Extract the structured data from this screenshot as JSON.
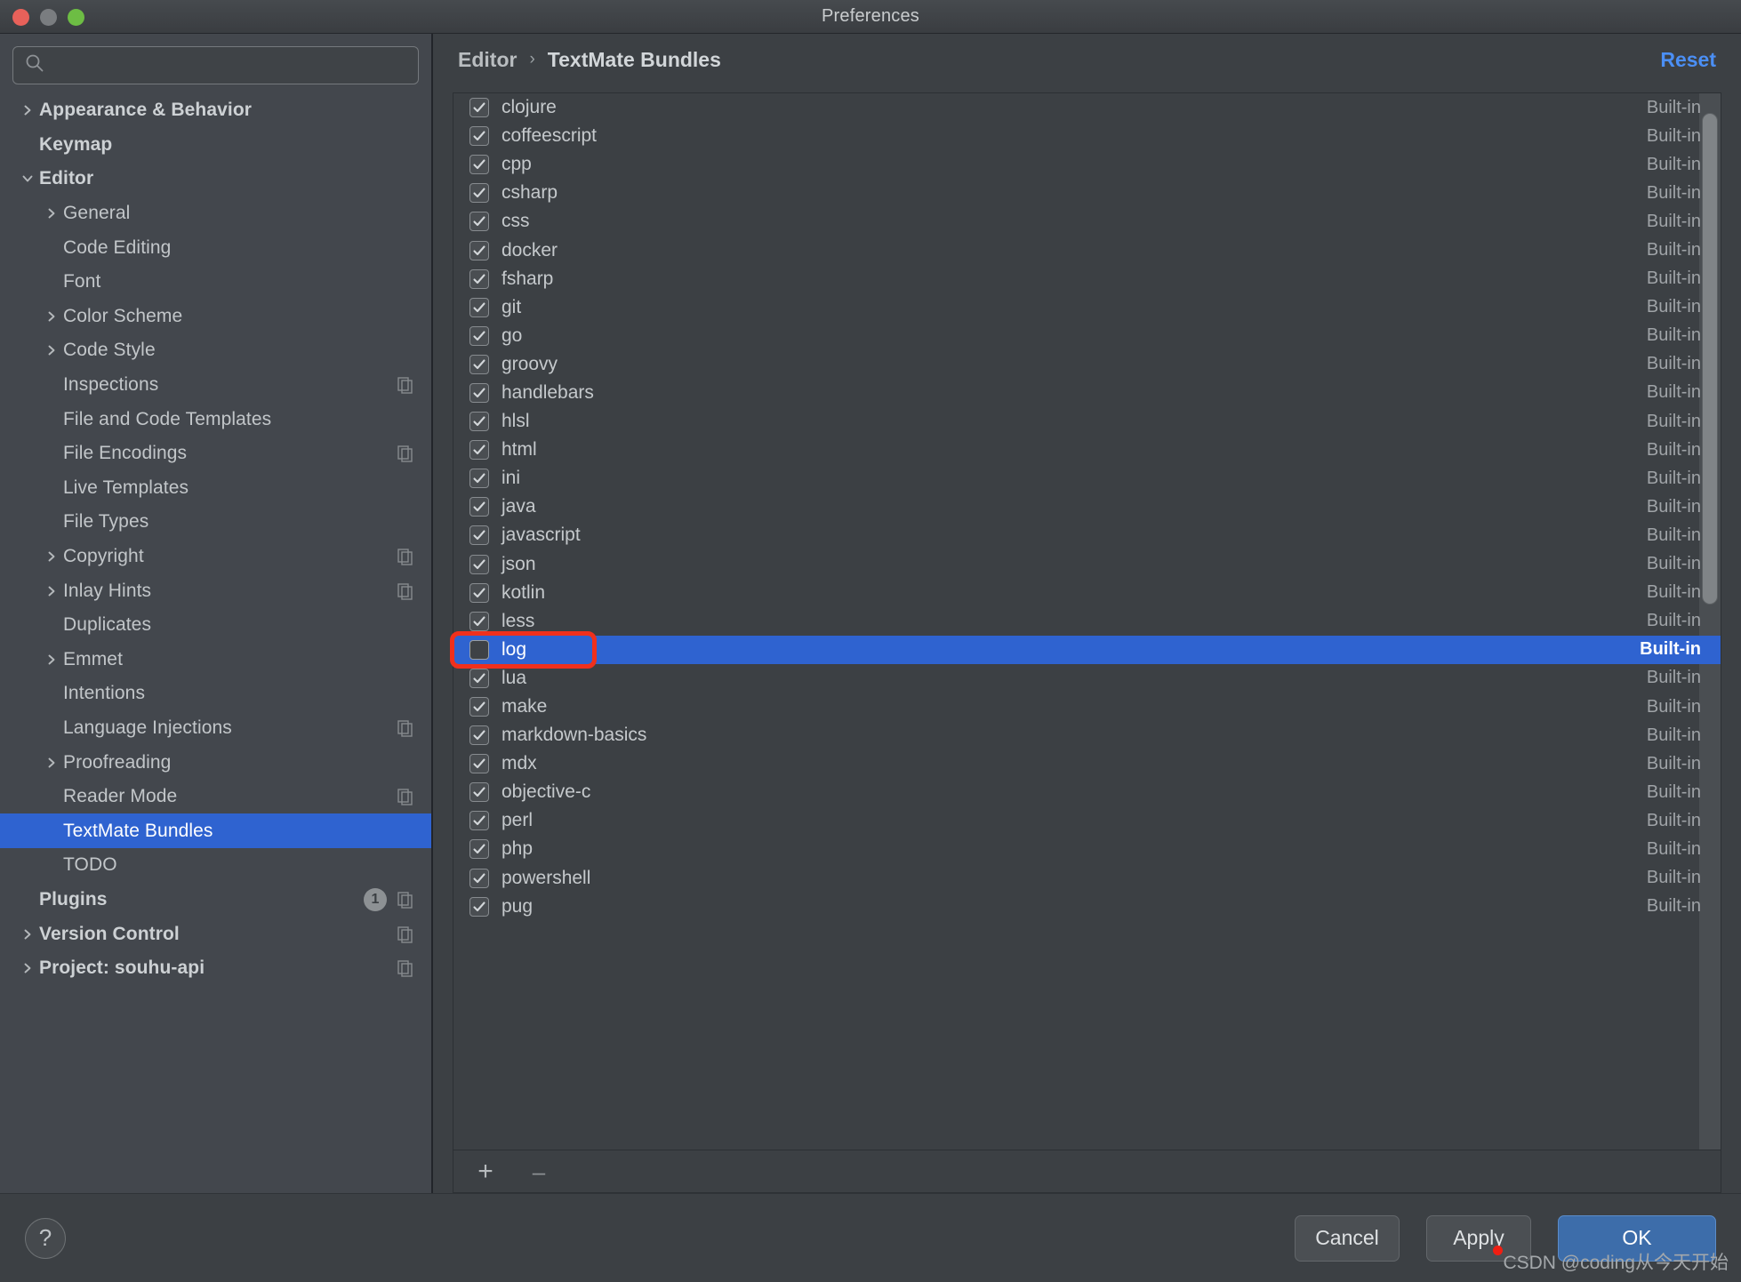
{
  "window": {
    "title": "Preferences",
    "traffic_lights": [
      "close-button",
      "minimize-button",
      "maximize-button"
    ]
  },
  "sidebar": {
    "search": {
      "value": "",
      "placeholder": ""
    },
    "items": [
      {
        "label": "Appearance & Behavior",
        "indent": 0,
        "arrow": "collapsed",
        "bold": true,
        "copy": false,
        "selected": false
      },
      {
        "label": "Keymap",
        "indent": 0,
        "arrow": "none",
        "bold": true,
        "copy": false,
        "selected": false
      },
      {
        "label": "Editor",
        "indent": 0,
        "arrow": "expanded",
        "bold": true,
        "copy": false,
        "selected": false
      },
      {
        "label": "General",
        "indent": 1,
        "arrow": "collapsed",
        "bold": false,
        "copy": false,
        "selected": false
      },
      {
        "label": "Code Editing",
        "indent": 1,
        "arrow": "none",
        "bold": false,
        "copy": false,
        "selected": false
      },
      {
        "label": "Font",
        "indent": 1,
        "arrow": "none",
        "bold": false,
        "copy": false,
        "selected": false
      },
      {
        "label": "Color Scheme",
        "indent": 1,
        "arrow": "collapsed",
        "bold": false,
        "copy": false,
        "selected": false
      },
      {
        "label": "Code Style",
        "indent": 1,
        "arrow": "collapsed",
        "bold": false,
        "copy": false,
        "selected": false
      },
      {
        "label": "Inspections",
        "indent": 1,
        "arrow": "none",
        "bold": false,
        "copy": true,
        "selected": false
      },
      {
        "label": "File and Code Templates",
        "indent": 1,
        "arrow": "none",
        "bold": false,
        "copy": false,
        "selected": false
      },
      {
        "label": "File Encodings",
        "indent": 1,
        "arrow": "none",
        "bold": false,
        "copy": true,
        "selected": false
      },
      {
        "label": "Live Templates",
        "indent": 1,
        "arrow": "none",
        "bold": false,
        "copy": false,
        "selected": false
      },
      {
        "label": "File Types",
        "indent": 1,
        "arrow": "none",
        "bold": false,
        "copy": false,
        "selected": false
      },
      {
        "label": "Copyright",
        "indent": 1,
        "arrow": "collapsed",
        "bold": false,
        "copy": true,
        "selected": false
      },
      {
        "label": "Inlay Hints",
        "indent": 1,
        "arrow": "collapsed",
        "bold": false,
        "copy": true,
        "selected": false
      },
      {
        "label": "Duplicates",
        "indent": 1,
        "arrow": "none",
        "bold": false,
        "copy": false,
        "selected": false
      },
      {
        "label": "Emmet",
        "indent": 1,
        "arrow": "collapsed",
        "bold": false,
        "copy": false,
        "selected": false
      },
      {
        "label": "Intentions",
        "indent": 1,
        "arrow": "none",
        "bold": false,
        "copy": false,
        "selected": false
      },
      {
        "label": "Language Injections",
        "indent": 1,
        "arrow": "none",
        "bold": false,
        "copy": true,
        "selected": false
      },
      {
        "label": "Proofreading",
        "indent": 1,
        "arrow": "collapsed",
        "bold": false,
        "copy": false,
        "selected": false
      },
      {
        "label": "Reader Mode",
        "indent": 1,
        "arrow": "none",
        "bold": false,
        "copy": true,
        "selected": false
      },
      {
        "label": "TextMate Bundles",
        "indent": 1,
        "arrow": "none",
        "bold": false,
        "copy": false,
        "selected": true
      },
      {
        "label": "TODO",
        "indent": 1,
        "arrow": "none",
        "bold": false,
        "copy": false,
        "selected": false
      },
      {
        "label": "Plugins",
        "indent": 0,
        "arrow": "none",
        "bold": true,
        "copy": true,
        "selected": false,
        "badge": "1"
      },
      {
        "label": "Version Control",
        "indent": 0,
        "arrow": "collapsed",
        "bold": true,
        "copy": true,
        "selected": false
      },
      {
        "label": "Project: souhu-api",
        "indent": 0,
        "arrow": "collapsed",
        "bold": true,
        "copy": true,
        "selected": false
      }
    ]
  },
  "main": {
    "breadcrumb": {
      "parent": "Editor",
      "separator": "›",
      "current": "TextMate Bundles"
    },
    "reset_label": "Reset",
    "origin_builtin": "Built-in",
    "toolbar": {
      "add_label": "+",
      "remove_label": "–"
    },
    "bundles": [
      {
        "name": "clojure",
        "checked": true,
        "origin": "Built-in",
        "selected": false
      },
      {
        "name": "coffeescript",
        "checked": true,
        "origin": "Built-in",
        "selected": false
      },
      {
        "name": "cpp",
        "checked": true,
        "origin": "Built-in",
        "selected": false
      },
      {
        "name": "csharp",
        "checked": true,
        "origin": "Built-in",
        "selected": false
      },
      {
        "name": "css",
        "checked": true,
        "origin": "Built-in",
        "selected": false
      },
      {
        "name": "docker",
        "checked": true,
        "origin": "Built-in",
        "selected": false
      },
      {
        "name": "fsharp",
        "checked": true,
        "origin": "Built-in",
        "selected": false
      },
      {
        "name": "git",
        "checked": true,
        "origin": "Built-in",
        "selected": false
      },
      {
        "name": "go",
        "checked": true,
        "origin": "Built-in",
        "selected": false
      },
      {
        "name": "groovy",
        "checked": true,
        "origin": "Built-in",
        "selected": false
      },
      {
        "name": "handlebars",
        "checked": true,
        "origin": "Built-in",
        "selected": false
      },
      {
        "name": "hlsl",
        "checked": true,
        "origin": "Built-in",
        "selected": false
      },
      {
        "name": "html",
        "checked": true,
        "origin": "Built-in",
        "selected": false
      },
      {
        "name": "ini",
        "checked": true,
        "origin": "Built-in",
        "selected": false
      },
      {
        "name": "java",
        "checked": true,
        "origin": "Built-in",
        "selected": false
      },
      {
        "name": "javascript",
        "checked": true,
        "origin": "Built-in",
        "selected": false
      },
      {
        "name": "json",
        "checked": true,
        "origin": "Built-in",
        "selected": false
      },
      {
        "name": "kotlin",
        "checked": true,
        "origin": "Built-in",
        "selected": false
      },
      {
        "name": "less",
        "checked": true,
        "origin": "Built-in",
        "selected": false
      },
      {
        "name": "log",
        "checked": false,
        "origin": "Built-in",
        "selected": true
      },
      {
        "name": "lua",
        "checked": true,
        "origin": "Built-in",
        "selected": false
      },
      {
        "name": "make",
        "checked": true,
        "origin": "Built-in",
        "selected": false
      },
      {
        "name": "markdown-basics",
        "checked": true,
        "origin": "Built-in",
        "selected": false
      },
      {
        "name": "mdx",
        "checked": true,
        "origin": "Built-in",
        "selected": false
      },
      {
        "name": "objective-c",
        "checked": true,
        "origin": "Built-in",
        "selected": false
      },
      {
        "name": "perl",
        "checked": true,
        "origin": "Built-in",
        "selected": false
      },
      {
        "name": "php",
        "checked": true,
        "origin": "Built-in",
        "selected": false
      },
      {
        "name": "powershell",
        "checked": true,
        "origin": "Built-in",
        "selected": false
      },
      {
        "name": "pug",
        "checked": true,
        "origin": "Built-in",
        "selected": false
      }
    ]
  },
  "footer": {
    "help_label": "?",
    "cancel_label": "Cancel",
    "apply_label": "Apply",
    "ok_label": "OK"
  },
  "watermark": "CSDN @coding从今天开始",
  "colors": {
    "selection_blue": "#2f63d0",
    "accent_link": "#4b8ff5",
    "annotation_red": "#f0301c",
    "ok_button": "#3d6daa",
    "window_bg": "#3c4044",
    "sidebar_bg": "#43474d"
  }
}
